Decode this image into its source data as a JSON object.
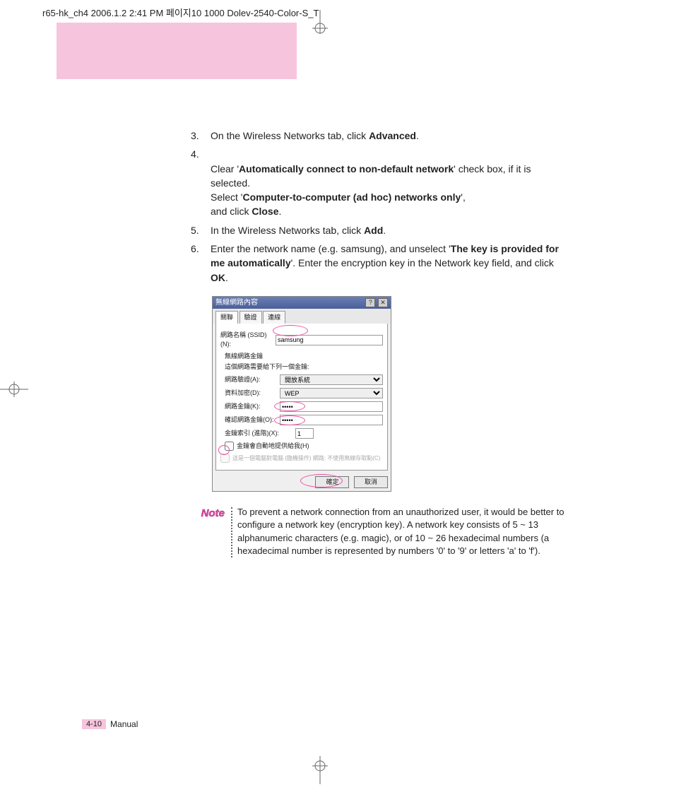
{
  "header_line": "r65-hk_ch4  2006.1.2 2:41 PM  페이지10   1000 Dolev-2540-Color-S_T",
  "steps": [
    {
      "num": "3.",
      "text_pre": "On the Wireless Networks tab, click ",
      "bold1": "Advanced",
      "text_post": "."
    },
    {
      "num": "4.",
      "text_pre": "Clear '",
      "bold1": "Automatically connect to non-default network",
      "text_mid": "' check box, if it is selected.\nSelect '",
      "bold2": "Computer-to-computer (ad hoc) networks only",
      "text_mid2": "',\nand click ",
      "bold3": "Close",
      "text_post": "."
    },
    {
      "num": "5.",
      "text_pre": "In the Wireless Networks tab, click ",
      "bold1": "Add",
      "text_post": "."
    },
    {
      "num": "6.",
      "text_pre": "Enter the network name (e.g. samsung), and unselect '",
      "bold1": "The key is provided for me automatically",
      "text_mid": "'. Enter the encryption key in the Network key field, and click ",
      "bold2": "OK",
      "text_post": "."
    }
  ],
  "dialog": {
    "title": "無線網路內容",
    "help_btn": "?",
    "close_btn": "✕",
    "tabs": [
      "關聯",
      "驗證",
      "連線"
    ],
    "ssid_label": "網路名稱 (SSID)(N):",
    "ssid_value": "samsung",
    "group1": "無線網路金鑰",
    "group1_sub": "這個網路需要給下列一個金鑰:",
    "auth_label": "網路驗證(A):",
    "auth_value": "開放系統",
    "enc_label": "資料加密(D):",
    "enc_value": "WEP",
    "key_label": "網路金鑰(K):",
    "key_value": "•••••",
    "key2_label": "確認網路金鑰(O):",
    "key2_value": "•••••",
    "index_label": "金鑰索引 (進階)(X):",
    "index_value": "1",
    "auto_key_label": "金鑰會自動地提供給我(H)",
    "adhoc_note": "這是一個電腦對電腦 (臨機操作) 網路; 不使用無線存取點(C)",
    "ok": "確定",
    "cancel": "取消"
  },
  "note_label": "Note",
  "note_text": "To prevent a network connection from an unauthorized user, it would be better to configure a network key (encryption key). A network key consists of 5 ~ 13 alphanumeric characters (e.g. magic), or of 10 ~ 26 hexadecimal numbers (a hexadecimal number is represented by numbers '0' to '9' or letters 'a' to 'f').",
  "footer_page": "4-10",
  "footer_label": "Manual"
}
